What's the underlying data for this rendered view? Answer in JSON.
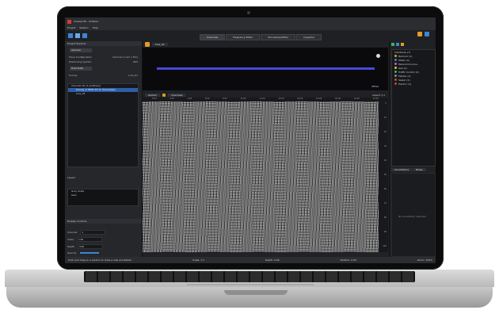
{
  "window": {
    "title": "Chassis PE - Untitled"
  },
  "menu": [
    "Project",
    "Seismic",
    "Help"
  ],
  "tabs": [
    "Overview",
    "Frequency Editor",
    "Processing Editor",
    "Inspector"
  ],
  "left_panel": {
    "title": "Project Explorer",
    "section_button": "General",
    "properties": [
      {
        "label": "Trace Configuration",
        "value": "Channel 1 (1m x 8m)"
      },
      {
        "label": "Positioning System",
        "value": "GPS"
      }
    ],
    "data_button": "Field Data",
    "group_label": "Survey",
    "group_value": "Line_01",
    "tree": [
      {
        "label": "Channel 1D (1 profile(s))",
        "selected": false
      },
      {
        "label": "Survey_A 0001.1D (1 channel(s))",
        "selected": true
      },
      {
        "label": "Line_01",
        "selected": false
      }
    ],
    "split_label": "Layers",
    "legend": [
      "Grey Scale",
      "Gain"
    ],
    "control_title": "Display Controls",
    "controls": [
      {
        "label": "Channel",
        "value": "1"
      },
      {
        "label": "Scale",
        "value": "1.00"
      },
      {
        "label": "Depth",
        "value": "0.00"
      },
      {
        "label": "Opacity",
        "value": ""
      }
    ]
  },
  "overview": {
    "header": "Line_01",
    "label": "Offset"
  },
  "section": {
    "tabs": [
      "Section",
      "Overview"
    ],
    "right_label": "Aspect 1:1",
    "ruler": [
      "0.00",
      "2.00",
      "4.00",
      "6.00",
      "8.00",
      "10.00",
      "12.00",
      "14.00",
      "16.00",
      "18.00",
      "20.00",
      "22.00",
      "24.00"
    ],
    "depth": [
      "0",
      "10",
      "20",
      "30",
      "40",
      "50",
      "60",
      "70",
      "80",
      "90",
      "100"
    ]
  },
  "right_panel": {
    "root": "Interfaces (7)",
    "layers": [
      {
        "label": "Bedrock (1)",
        "color": "#e0a020"
      },
      {
        "label": "Water (1)",
        "color": "#3b86d6"
      },
      {
        "label": "Telecommunica...",
        "color": "#cc55cc"
      },
      {
        "label": "Gas (1)",
        "color": "#e0c020"
      },
      {
        "label": "Traffic Control (1)",
        "color": "#3bb06a"
      },
      {
        "label": "Marker (1)",
        "color": "#8a8a8a"
      },
      {
        "label": "Sewer (1)",
        "color": "#a06030"
      },
      {
        "label": "Electric (1)",
        "color": "#d63b2f"
      }
    ],
    "tabs": [
      "Annotations",
      "Notes"
    ],
    "empty_text": "No annotation selected"
  },
  "status": {
    "left": "Click and drag on a section to draw a new annotation",
    "right": [
      "Scale: 1:1",
      "Depth: 0.00",
      "Position: 0.00",
      "Zoom: 100%"
    ]
  },
  "colors": {
    "accent": "#3b86d6",
    "overview_line": "#4848d8"
  }
}
